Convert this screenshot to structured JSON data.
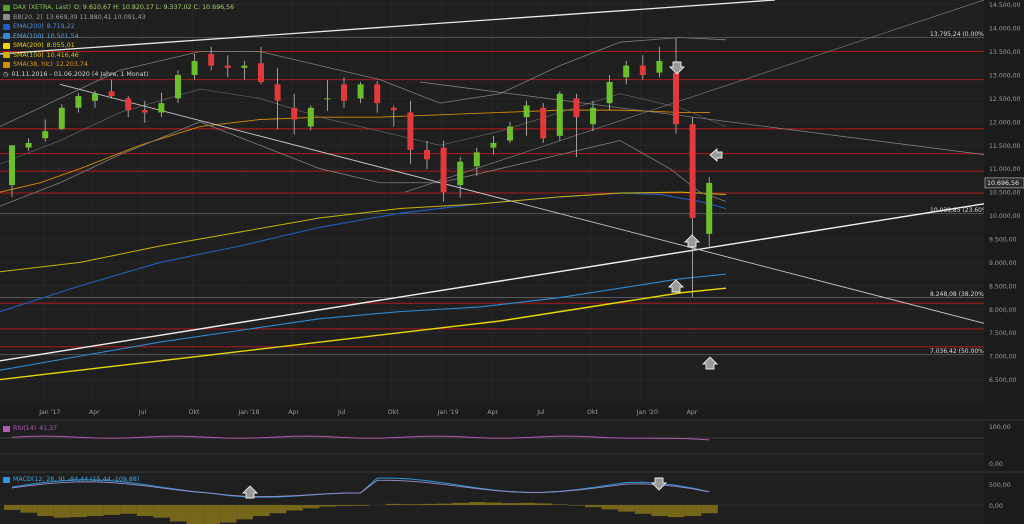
{
  "chart_data": {
    "type": "candlestick",
    "legend": {
      "header": "DAX (XETRA, Last)",
      "ohlc": "O: 9.610,67  H: 10.820,17  L: 9.337,02  C: 10.696,56",
      "indicators": [
        {
          "label": "BB(20, 2)",
          "values": "13.669,39  11.880,41  10.091,43",
          "color": "#8a8a8a"
        },
        {
          "label": "EMA(200)",
          "values": "8.719,22",
          "color": "#1e5fbf"
        },
        {
          "label": "EMA(100)",
          "values": "10.501,54",
          "color": "#2a8cd8"
        },
        {
          "label": "SMA(200)",
          "values": "8.055,01",
          "color": "#e6d800"
        },
        {
          "label": "SMA(100)",
          "values": "10.416,46",
          "color": "#c8b400"
        },
        {
          "label": "SMA(38, hlc)",
          "values": "12.203,74",
          "color": "#d68a00"
        }
      ],
      "period": "01.11.2016 - 01.06.2020   (4 Jahre, 1 Monat)"
    },
    "x_ticks": [
      "Jan '17",
      "Apr",
      "Jul",
      "Okt",
      "Jan '18",
      "Apr",
      "Jul",
      "Okt",
      "Jan '19",
      "Apr",
      "Jul",
      "Okt",
      "Jan '20",
      "Apr"
    ],
    "y_ticks": [
      "14.500,00",
      "14.000,00",
      "13.500,00",
      "13.000,00",
      "12.500,00",
      "12.000,00",
      "11.500,00",
      "11.000,00",
      "10.500,00",
      "10.000,00",
      "9.500,00",
      "9.000,00",
      "8.500,00",
      "8.000,00",
      "7.500,00",
      "7.000,00",
      "6.500,00"
    ],
    "ylim": [
      6000,
      14600
    ],
    "y_tick_values": [
      14500,
      14000,
      13500,
      13000,
      12500,
      12000,
      11500,
      11000,
      10500,
      10000,
      9500,
      9000,
      8500,
      8000,
      7500,
      7000,
      6500
    ],
    "last_price": {
      "value": 10696.56,
      "label": "10.696,56",
      "color": "#e8e8e8"
    },
    "fib_levels": [
      {
        "value": 13795.24,
        "label": "13.795,24 (0.00%)"
      },
      {
        "value": 10039.85,
        "label": "10.039,85 (23.60%)"
      },
      {
        "value": 8248.08,
        "label": "8.248,08 (38.20%)"
      },
      {
        "value": 7036.42,
        "label": "7.036,42 (50.00%)"
      }
    ],
    "red_levels": [
      13500,
      12900,
      11850,
      11320,
      10950,
      10480,
      8130,
      7580,
      7200
    ],
    "candles": [
      {
        "o": 10650,
        "h": 10870,
        "l": 10400,
        "c": 11500
      },
      {
        "o": 11450,
        "h": 11650,
        "l": 11380,
        "c": 11550
      },
      {
        "o": 11650,
        "h": 12050,
        "l": 11580,
        "c": 11800
      },
      {
        "o": 11850,
        "h": 12380,
        "l": 11820,
        "c": 12300
      },
      {
        "o": 12300,
        "h": 12610,
        "l": 12200,
        "c": 12550
      },
      {
        "o": 12450,
        "h": 12660,
        "l": 12300,
        "c": 12600
      },
      {
        "o": 12650,
        "h": 12900,
        "l": 12500,
        "c": 12550
      },
      {
        "o": 12500,
        "h": 12550,
        "l": 12100,
        "c": 12250
      },
      {
        "o": 12250,
        "h": 12450,
        "l": 11980,
        "c": 12200
      },
      {
        "o": 12200,
        "h": 12620,
        "l": 12100,
        "c": 12400
      },
      {
        "o": 12500,
        "h": 13100,
        "l": 12400,
        "c": 13000
      },
      {
        "o": 13000,
        "h": 13450,
        "l": 12900,
        "c": 13300
      },
      {
        "o": 13450,
        "h": 13600,
        "l": 13100,
        "c": 13200
      },
      {
        "o": 13200,
        "h": 13420,
        "l": 12950,
        "c": 13150
      },
      {
        "o": 13150,
        "h": 13300,
        "l": 12900,
        "c": 13200
      },
      {
        "o": 13250,
        "h": 13600,
        "l": 12800,
        "c": 12850
      },
      {
        "o": 12800,
        "h": 13150,
        "l": 11850,
        "c": 12450
      },
      {
        "o": 12300,
        "h": 12600,
        "l": 11730,
        "c": 12050
      },
      {
        "o": 11900,
        "h": 12350,
        "l": 11820,
        "c": 12300
      },
      {
        "o": 12500,
        "h": 12890,
        "l": 12230,
        "c": 12500
      },
      {
        "o": 12800,
        "h": 12950,
        "l": 12300,
        "c": 12450
      },
      {
        "o": 12500,
        "h": 12850,
        "l": 12400,
        "c": 12800
      },
      {
        "o": 12800,
        "h": 12870,
        "l": 12200,
        "c": 12400
      },
      {
        "o": 12300,
        "h": 12350,
        "l": 11900,
        "c": 12250
      },
      {
        "o": 12200,
        "h": 12450,
        "l": 11100,
        "c": 11400
      },
      {
        "o": 11400,
        "h": 11600,
        "l": 11000,
        "c": 11200
      },
      {
        "o": 11450,
        "h": 11600,
        "l": 10300,
        "c": 10500
      },
      {
        "o": 10650,
        "h": 11250,
        "l": 10380,
        "c": 11150
      },
      {
        "o": 11050,
        "h": 11450,
        "l": 10850,
        "c": 11350
      },
      {
        "o": 11450,
        "h": 11700,
        "l": 11300,
        "c": 11550
      },
      {
        "o": 11600,
        "h": 12000,
        "l": 11550,
        "c": 11900
      },
      {
        "o": 12100,
        "h": 12450,
        "l": 11700,
        "c": 12350
      },
      {
        "o": 12300,
        "h": 12400,
        "l": 11550,
        "c": 11650
      },
      {
        "o": 11700,
        "h": 12650,
        "l": 11600,
        "c": 12600
      },
      {
        "o": 12500,
        "h": 12600,
        "l": 11250,
        "c": 12100
      },
      {
        "o": 11950,
        "h": 12450,
        "l": 11800,
        "c": 12300
      },
      {
        "o": 12400,
        "h": 13000,
        "l": 12250,
        "c": 12850
      },
      {
        "o": 12950,
        "h": 13300,
        "l": 12800,
        "c": 13200
      },
      {
        "o": 13200,
        "h": 13420,
        "l": 12900,
        "c": 13000
      },
      {
        "o": 13050,
        "h": 13600,
        "l": 12950,
        "c": 13300
      },
      {
        "o": 13050,
        "h": 13795,
        "l": 11750,
        "c": 11950
      },
      {
        "o": 11950,
        "h": 12100,
        "l": 8260,
        "c": 9950
      },
      {
        "o": 9610.67,
        "h": 10820.17,
        "l": 9337.02,
        "c": 10696.56
      }
    ],
    "rsi": {
      "label": "RSI(14)",
      "value": "41,37",
      "ticks": [
        "100,00",
        "0,00"
      ],
      "color": "#b05bb0"
    },
    "macd": {
      "label": "MACD(12, 26, 9)",
      "values": "-94,44  (15,44  -109,88)",
      "ticks": [
        "500,00",
        "0,00"
      ],
      "color": "#2a9ad8",
      "hist": [
        -90,
        -140,
        -200,
        -230,
        -220,
        -200,
        -180,
        -160,
        -200,
        -230,
        -300,
        -350,
        -380,
        -320,
        -260,
        -200,
        -150,
        -100,
        -60,
        -30,
        -20,
        -15,
        0,
        20,
        15,
        20,
        25,
        40,
        55,
        45,
        35,
        40,
        30,
        10,
        -10,
        -40,
        -80,
        -120,
        -160,
        -200,
        -220,
        -200,
        -150
      ]
    }
  }
}
